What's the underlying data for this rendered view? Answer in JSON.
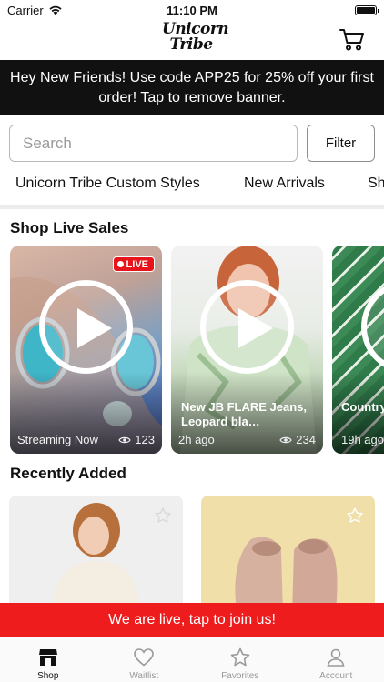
{
  "status_bar": {
    "carrier": "Carrier",
    "time": "11:10 PM"
  },
  "header": {
    "logo_line1": "Unicorn",
    "logo_line2": "Tribe"
  },
  "banner": {
    "text": "Hey New Friends! Use code APP25 for 25% off your first order! Tap to remove banner."
  },
  "search": {
    "placeholder": "Search",
    "filter_label": "Filter"
  },
  "categories": [
    "Unicorn Tribe Custom Styles",
    "New Arrivals",
    "Sh"
  ],
  "live_sales": {
    "title": "Shop Live Sales",
    "cards": [
      {
        "badge": "LIVE",
        "title": "",
        "meta_left": "Streaming Now",
        "views": "123"
      },
      {
        "badge": "",
        "title": "New JB FLARE Jeans, Leopard bla…",
        "meta_left": "2h ago",
        "views": "234"
      },
      {
        "badge": "",
        "title": "Country St Patty",
        "meta_left": "19h ago",
        "views": ""
      }
    ]
  },
  "recently_added": {
    "title": "Recently Added"
  },
  "live_bar": {
    "text": "We are live, tap to join us!"
  },
  "tabs": [
    {
      "label": "Shop",
      "icon": "shop-icon",
      "active": true
    },
    {
      "label": "Waitlist",
      "icon": "heart-icon",
      "active": false
    },
    {
      "label": "Favorites",
      "icon": "star-icon",
      "active": false
    },
    {
      "label": "Account",
      "icon": "person-icon",
      "active": false
    }
  ],
  "colors": {
    "accent_red": "#ee1c1c",
    "banner_black": "#111111",
    "live_badge": "#e8141b"
  }
}
